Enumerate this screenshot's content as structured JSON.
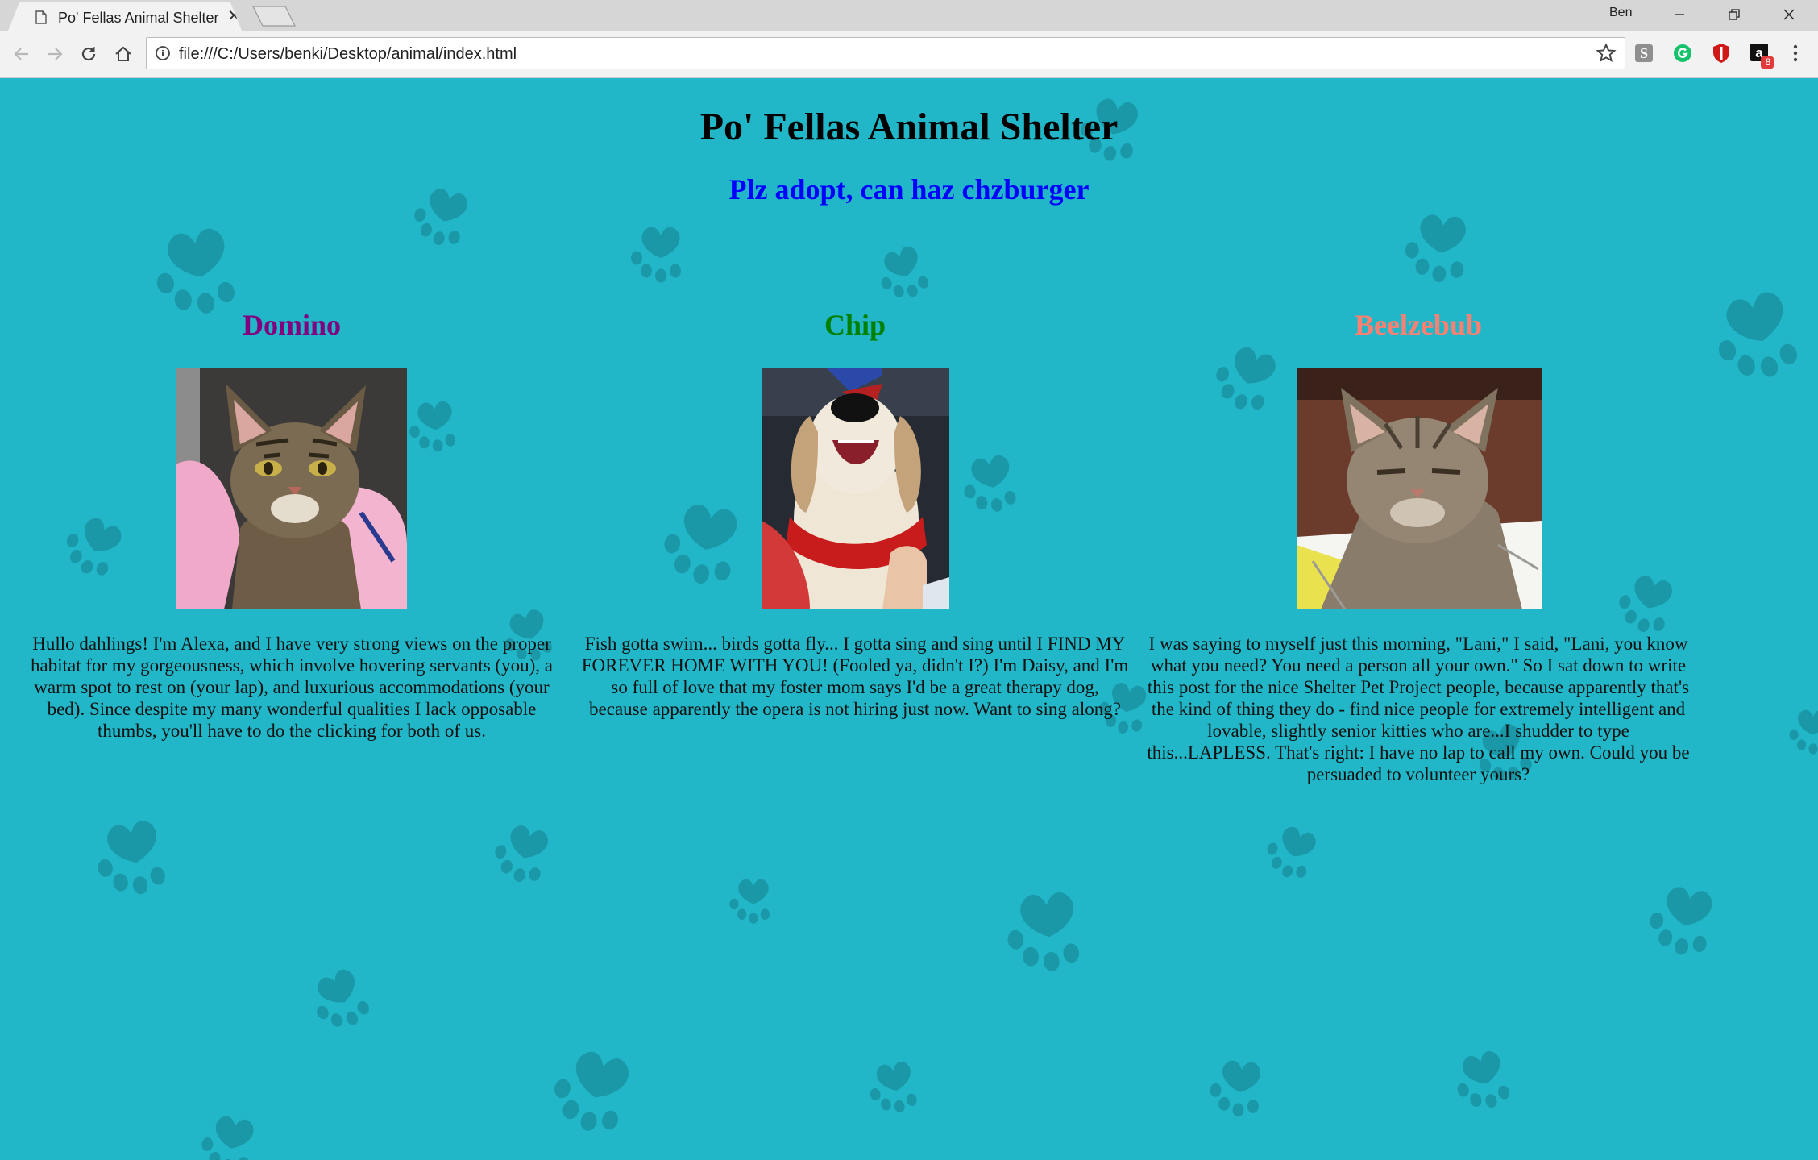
{
  "browser": {
    "tab_title": "Po' Fellas Animal Shelter",
    "profile_name": "Ben",
    "url": "file:///C:/Users/benki/Desktop/animal/index.html",
    "extension_badge": "8"
  },
  "page": {
    "title": "Po' Fellas Animal Shelter",
    "subtitle": "Plz adopt, can haz chzburger",
    "colors": {
      "background": "#22b7c8",
      "paw": "#1a98a8",
      "subtitle": "#0000ff",
      "domino": "#800080",
      "chip": "#008000",
      "beelzebub": "#fa8072"
    },
    "pets": [
      {
        "name": "Domino",
        "photo": "tabby-cat-on-pink-blanket",
        "description": "Hullo dahlings! I'm Alexa, and I have very strong views on the proper habitat for my gorgeousness, which involve hovering servants (you), a warm spot to rest on (your lap), and luxurious accommodations (your bed). Since despite my many wonderful qualities I lack opposable thumbs, you'll have to do the clicking for both of us."
      },
      {
        "name": "Chip",
        "photo": "beagle-with-red-bandana",
        "description": "Fish gotta swim... birds gotta fly... I gotta sing and sing until I FIND MY FOREVER HOME WITH YOU! (Fooled ya, didn't I?) I'm Daisy, and I'm so full of love that my foster mom says I'd be a great therapy dog, because apparently the opera is not hiring just now. Want to sing along?"
      },
      {
        "name": "Beelzebub",
        "photo": "grey-tabby-cat-on-papers",
        "description": "I was saying to myself just this morning, \"Lani,\" I said, \"Lani, you know what you need? You need a person all your own.\" So I sat down to write this post for the nice Shelter Pet Project people, because apparently that's the kind of thing they do - find nice people for extremely intelligent and lovable, slightly senior kitties who are...I shudder to type this...LAPLESS. That's right: I have no lap to call my own. Could you be persuaded to volunteer yours?"
      }
    ]
  }
}
